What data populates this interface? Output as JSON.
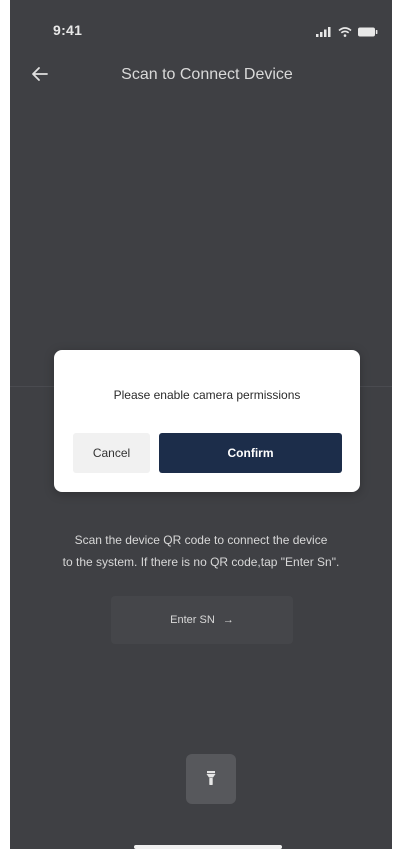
{
  "status_bar": {
    "time": "9:41",
    "icons": [
      "signal-icon",
      "wifi-icon",
      "battery-icon"
    ]
  },
  "nav": {
    "back_icon": "back-arrow-icon",
    "title": "Scan to Connect Device"
  },
  "dialog": {
    "message": "Please enable camera permissions",
    "cancel_label": "Cancel",
    "confirm_label": "Confirm"
  },
  "instructions": {
    "line1": "Scan the device QR code to connect the device",
    "line2": "to the system.  If there is no QR code,tap \"Enter Sn\"."
  },
  "enter_sn": {
    "label": "Enter SN",
    "arrow": "→"
  },
  "flashlight": {
    "icon": "flashlight-icon"
  },
  "colors": {
    "background": "#3f4044",
    "dialog_background": "#ffffff",
    "confirm_button": "#1c2d4a",
    "cancel_button": "#f1f1f1",
    "text_light": "#d8d8d8"
  }
}
